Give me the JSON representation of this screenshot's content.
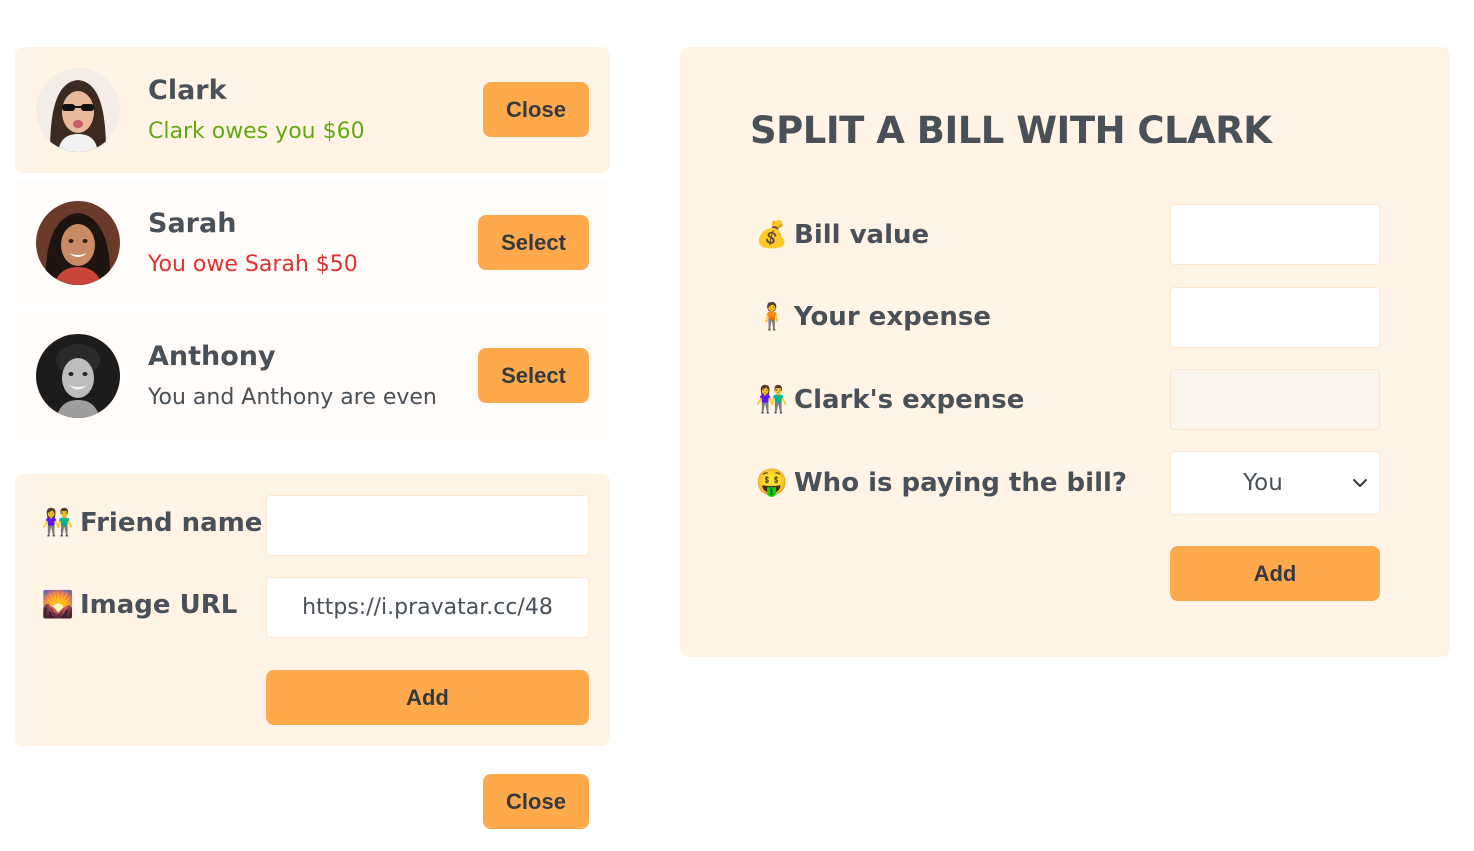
{
  "friends": [
    {
      "name": "Clark",
      "status": "Clark owes you $60",
      "button": "Close"
    },
    {
      "name": "Sarah",
      "status": "You owe Sarah $50",
      "button": "Select"
    },
    {
      "name": "Anthony",
      "status": "You and Anthony are even",
      "button": "Select"
    }
  ],
  "add_friend": {
    "name_label": "Friend name",
    "name_emoji": "👫",
    "name_value": "",
    "image_label": "Image URL",
    "image_emoji": "🌄",
    "image_value": "https://i.pravatar.cc/48",
    "add_label": "Add"
  },
  "close_label": "Close",
  "split": {
    "title": "SPLIT A BILL WITH CLARK",
    "bill_label": "Bill value",
    "bill_emoji": "💰",
    "bill_value": "",
    "your_label": "Your expense",
    "your_emoji": "🧍",
    "your_value": "",
    "friend_label": "Clark's expense",
    "friend_emoji": "👫",
    "friend_value": "",
    "payer_label": "Who is paying the bill?",
    "payer_emoji": "🤑",
    "payer_value": "You",
    "add_label": "Add"
  }
}
